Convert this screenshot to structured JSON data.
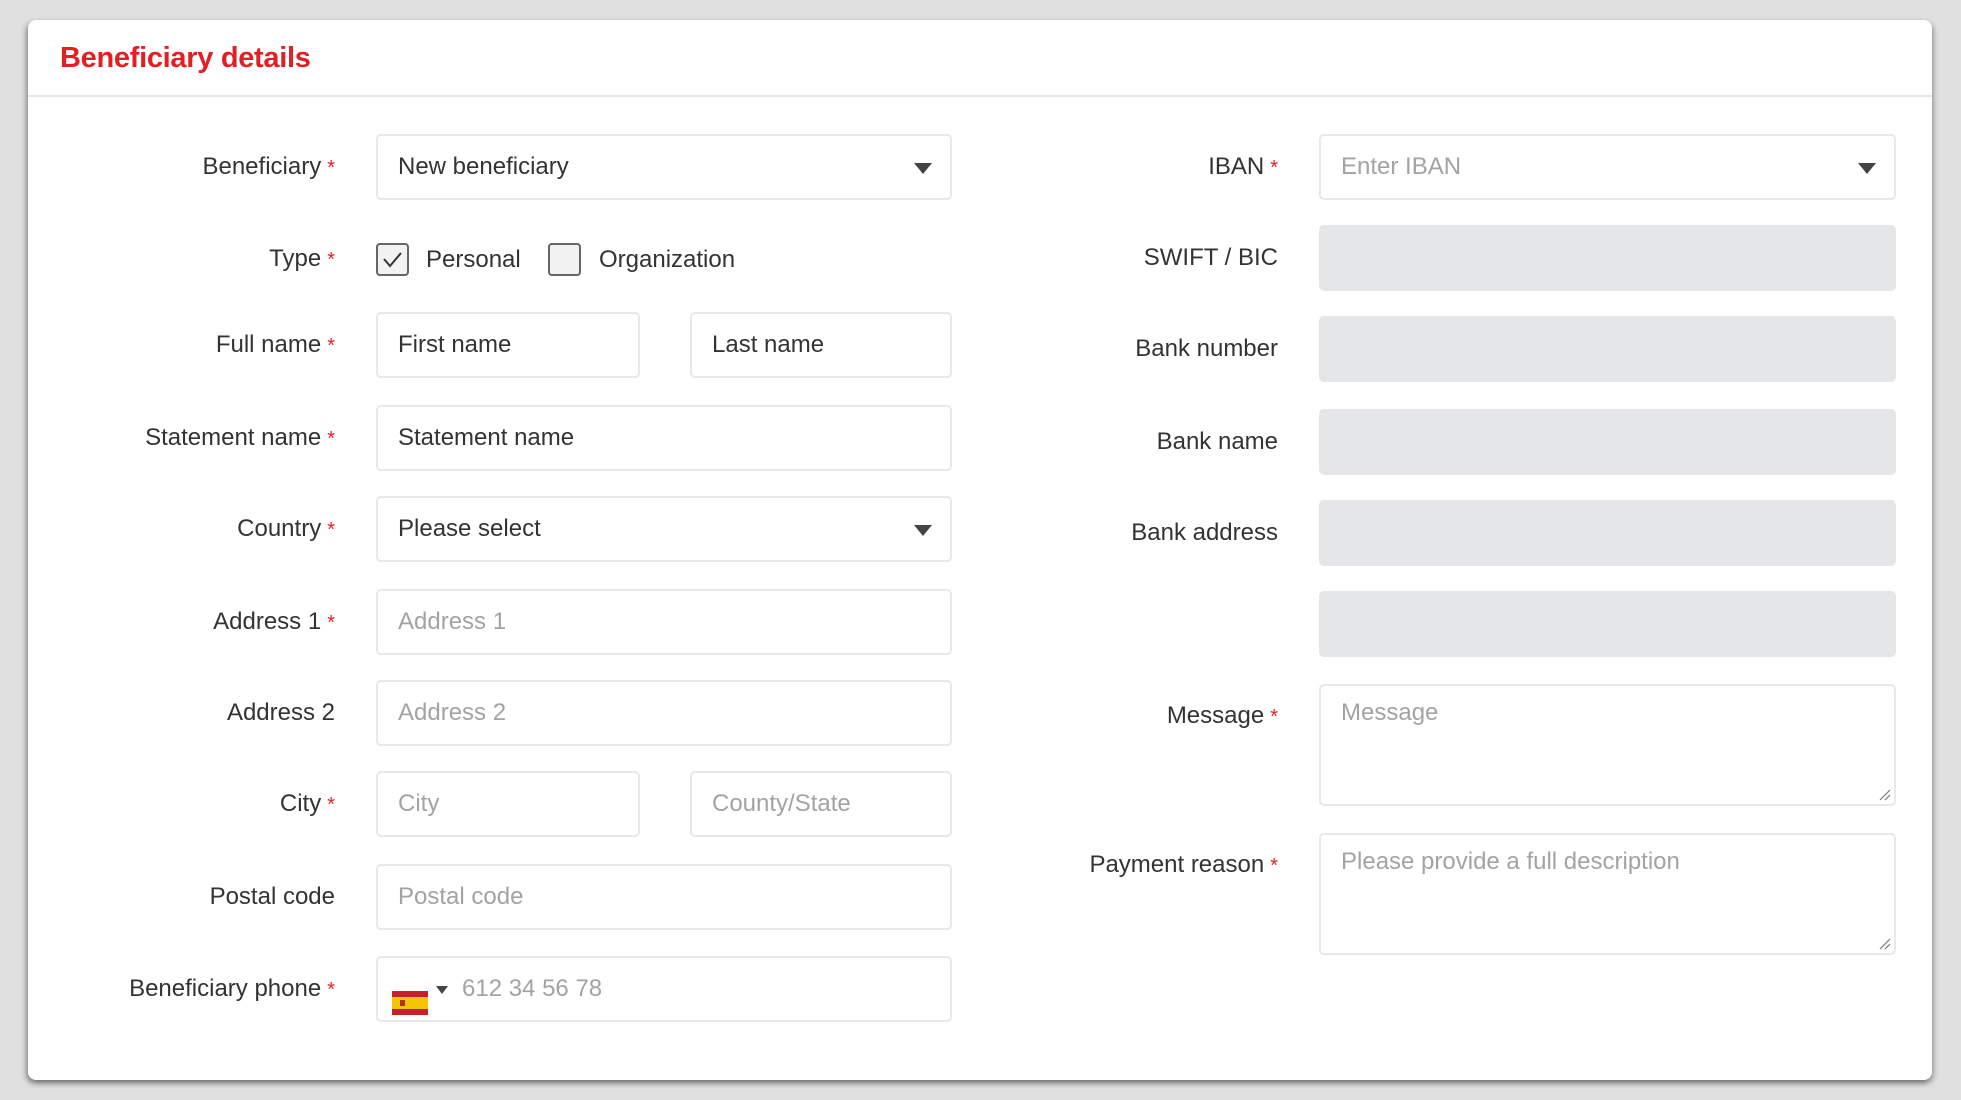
{
  "card": {
    "title": "Beneficiary details"
  },
  "colors": {
    "accent": "#e31e24",
    "disabled_field": "#e5e6e8",
    "placeholder": "#a3a3a3",
    "text": "#333333"
  },
  "left": {
    "beneficiary": {
      "label": "Beneficiary",
      "required": true,
      "value": "New beneficiary",
      "icon": "chevron-down-icon"
    },
    "type": {
      "label": "Type",
      "required": true,
      "options": [
        {
          "label": "Personal",
          "checked": true
        },
        {
          "label": "Organization",
          "checked": false
        }
      ]
    },
    "full_name": {
      "label": "Full name",
      "required": true,
      "first_value": "First name",
      "last_value": "Last name"
    },
    "statement_name": {
      "label": "Statement name",
      "required": true,
      "value": "Statement name"
    },
    "country": {
      "label": "Country",
      "required": true,
      "value": "Please select",
      "icon": "chevron-down-icon"
    },
    "address1": {
      "label": "Address 1",
      "required": true,
      "placeholder": "Address 1"
    },
    "address2": {
      "label": "Address 2",
      "required": false,
      "placeholder": "Address 2"
    },
    "city": {
      "label": "City",
      "required": true,
      "city_placeholder": "City",
      "state_placeholder": "County/State"
    },
    "postal_code": {
      "label": "Postal code",
      "required": false,
      "placeholder": "Postal code"
    },
    "phone": {
      "label": "Beneficiary phone",
      "required": true,
      "country_flag": "spain-flag-icon",
      "placeholder": "612 34 56 78"
    }
  },
  "right": {
    "iban": {
      "label": "IBAN",
      "required": true,
      "placeholder": "Enter IBAN",
      "icon": "chevron-down-icon"
    },
    "swift": {
      "label": "SWIFT / BIC",
      "required": false,
      "value": ""
    },
    "bank_number": {
      "label": "Bank number",
      "required": false,
      "value": ""
    },
    "bank_name": {
      "label": "Bank name",
      "required": false,
      "value": ""
    },
    "bank_address": {
      "label": "Bank address",
      "required": false,
      "value": ""
    },
    "bank_address2": {
      "value": ""
    },
    "message": {
      "label": "Message",
      "required": true,
      "placeholder": "Message"
    },
    "payment_reason": {
      "label": "Payment reason",
      "required": true,
      "placeholder": "Please provide a full description"
    }
  },
  "required_marker": "*"
}
